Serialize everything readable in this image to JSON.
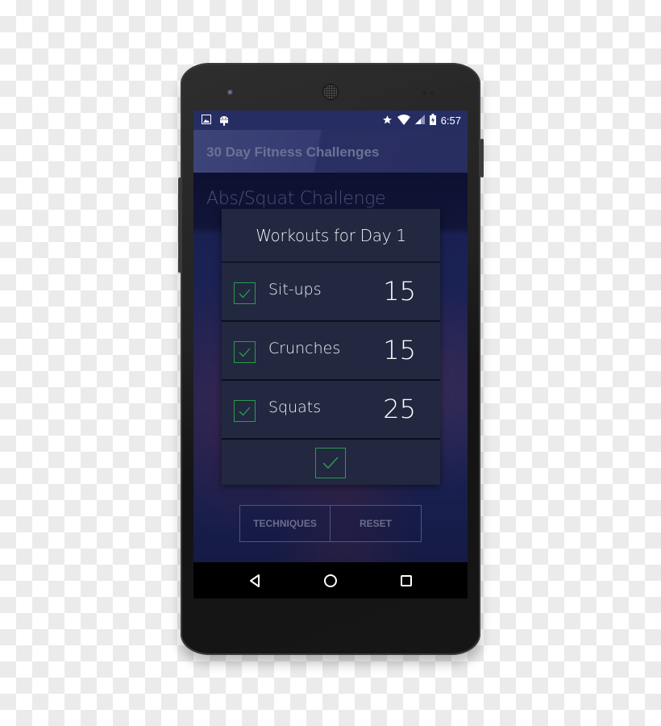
{
  "status_bar": {
    "left_icons": [
      "image-icon",
      "android-debug-icon"
    ],
    "right_icons": [
      "star-icon",
      "wifi-icon",
      "cell-signal-icon",
      "battery-charging-icon"
    ],
    "time": "6:57"
  },
  "app_bar": {
    "title": "30 Day Fitness Challenges"
  },
  "content": {
    "challenge_title": "Abs/Squat Challenge"
  },
  "dialog": {
    "title": "Workouts for Day 1",
    "workouts": [
      {
        "name": "Sit-ups",
        "count": "15",
        "checked": true
      },
      {
        "name": "Crunches",
        "count": "15",
        "checked": true
      },
      {
        "name": "Squats",
        "count": "25",
        "checked": true
      }
    ],
    "confirm_checked": true
  },
  "buttons": {
    "techniques": "TECHNIQUES",
    "reset": "RESET"
  },
  "nav_bar": {
    "items": [
      "back-icon",
      "home-icon",
      "recents-icon"
    ]
  },
  "colors": {
    "accent_check": "#2d9a4c",
    "app_bar": "#353b70",
    "status_bar": "#262d63",
    "dialog_bg": "#222840"
  }
}
